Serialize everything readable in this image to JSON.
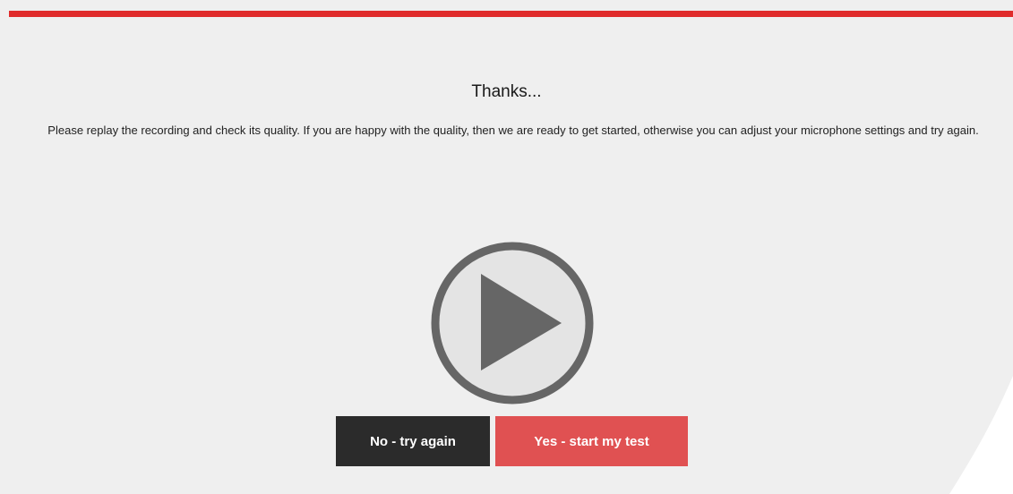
{
  "colors": {
    "accent": "#e02b2b",
    "background": "#efefef",
    "play_icon": "#666666",
    "no_button": "#2b2b2b",
    "yes_button": "#e05152"
  },
  "heading": "Thanks...",
  "message": "Please replay the recording and check its quality. If you are happy with the quality, then we are ready to get started, otherwise you can adjust your microphone settings and try again.",
  "player": {
    "icon": "play-circle-icon"
  },
  "actions": {
    "no_label": "No - try again",
    "yes_label": "Yes - start my test"
  }
}
